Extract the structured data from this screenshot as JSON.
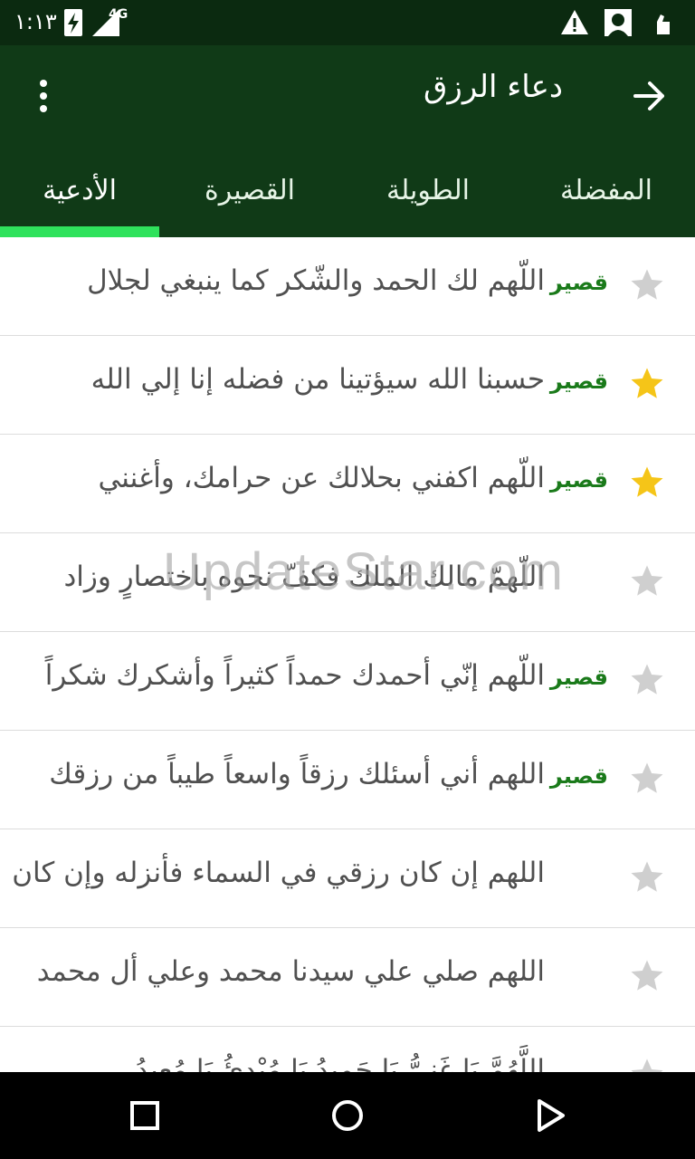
{
  "status_bar": {
    "time": "١:١٣",
    "network": "4G",
    "icons": [
      "battery-charging-icon",
      "signal-icon",
      "warning-icon",
      "app-notification-icon",
      "hand-notification-icon"
    ]
  },
  "app_bar": {
    "title": "دعاء الرزق"
  },
  "tabs": [
    {
      "label": "الأدعية",
      "active": true
    },
    {
      "label": "القصيرة",
      "active": false
    },
    {
      "label": "الطويلة",
      "active": false
    },
    {
      "label": "المفضلة",
      "active": false
    }
  ],
  "list": {
    "items": [
      {
        "text": "اللّهم لك الحمد والشّكر كما ينبغي لجلال",
        "badge": "قصير",
        "starred": false
      },
      {
        "text": "حسبنا الله سيؤتينا من فضله إنا إلي الله",
        "badge": "قصير",
        "starred": true
      },
      {
        "text": "اللّهم اكفني بحلالك عن حرامك، وأغنني",
        "badge": "قصير",
        "starred": true
      },
      {
        "text": "اللّهمّ مالك الملك فكفّ نحوه باختصارٍ وزاد",
        "badge": "",
        "starred": false
      },
      {
        "text": "اللّهم إنّي أحمدك حمداً كثيراً وأشكرك شكراً",
        "badge": "قصير",
        "starred": false
      },
      {
        "text": "اللهم أني أسئلك رزقاً واسعاً طيباً من رزقك",
        "badge": "قصير",
        "starred": false
      },
      {
        "text": "اللهم إن كان رزقي في السماء فأنزله وإن كان",
        "badge": "",
        "starred": false
      },
      {
        "text": "اللهم صلي علي سيدنا محمد وعلي أل محمد",
        "badge": "",
        "starred": false
      },
      {
        "text": "اللَّهُمَّ يَا غَنِيُّ يَا حَمِيدُ يَا مُبْدِئُ يَا مُعِيدُ",
        "badge": "",
        "starred": false
      }
    ]
  },
  "watermark": "UpdateStar.com",
  "colors": {
    "status_bar": "#0b2a10",
    "app_bar": "#103a17",
    "tab_indicator": "#2fe25c",
    "badge": "#1a7a1a",
    "star_active": "#f5c518",
    "star_inactive": "#cfcfcf"
  },
  "nav_bar": {
    "buttons": [
      "recents-icon",
      "home-icon",
      "back-icon"
    ]
  }
}
